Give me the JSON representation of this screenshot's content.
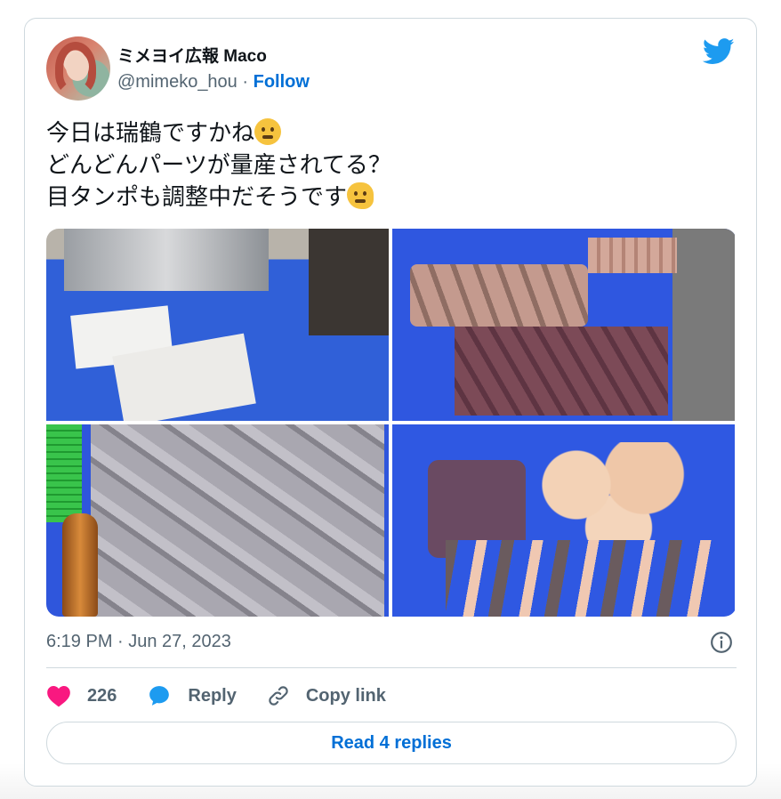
{
  "author": {
    "name": "ミメヨイ広報 Maco",
    "handle": "@mimeko_hou",
    "separator": "·",
    "follow_label": "Follow"
  },
  "tweet": {
    "lines": [
      "今日は瑞鶴ですかね",
      "どんどんパーツが量産されてる？",
      "目タンポも調整中だそうです"
    ],
    "emojis": [
      "thinking-face-emoji",
      "melting-face-emoji"
    ],
    "photos": [
      "photo-machine-and-parts",
      "photo-parts-in-crates",
      "photo-gray-parts-bin",
      "photo-skin-parts-bin"
    ]
  },
  "meta": {
    "timestamp": "6:19 PM · Jun 27, 2023",
    "info_icon": "info-icon"
  },
  "actions": {
    "like_count": "226",
    "reply_label": "Reply",
    "copy_link_label": "Copy link"
  },
  "read_replies_label": "Read 4 replies",
  "colors": {
    "accent": "#006fd6",
    "twitter_blue": "#1d9bf0",
    "heart": "#f91880",
    "secondary_text": "#536471",
    "border": "#cfd9de"
  }
}
